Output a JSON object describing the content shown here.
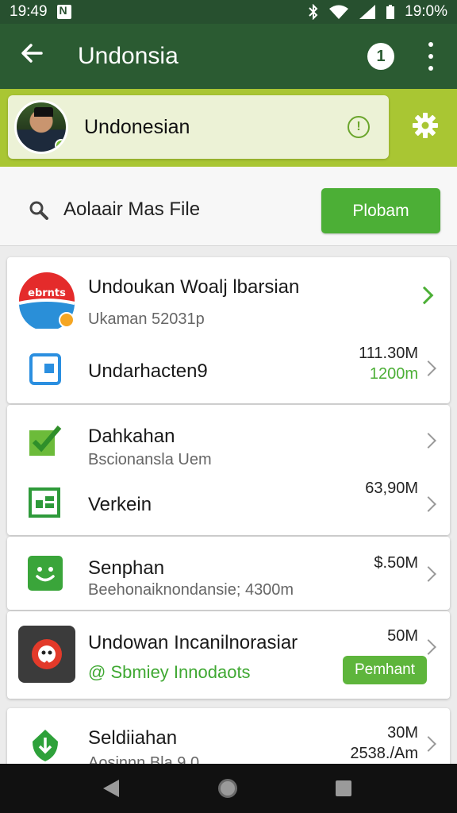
{
  "status": {
    "time": "19:49",
    "battery": "19:0%"
  },
  "appbar": {
    "title": "Undonsia",
    "info_label": "1"
  },
  "account": {
    "name": "Undonesian"
  },
  "search": {
    "label": "Aolaair Mas File",
    "button": "Plobam"
  },
  "cards": [
    {
      "rows": [
        {
          "title": "Undoukan Woalj lbarsian",
          "subtitle": "Ukaman 52031p",
          "icon": "brand-logo-icon"
        },
        {
          "title": "Undarhacten9",
          "size": "111.30M",
          "size2": "1200m",
          "icon": "tablet-icon"
        }
      ]
    },
    {
      "rows": [
        {
          "title": "Dahkahan",
          "subtitle": "Bscionansla Uem",
          "icon": "checkmark-icon"
        },
        {
          "title": "Verkein",
          "size": "63,90M",
          "icon": "spreadsheet-icon"
        }
      ]
    },
    {
      "rows": [
        {
          "title": "Senphan",
          "subtitle": "Beehonaiknondansie; 4300m",
          "size": "$.50M",
          "icon": "smiley-icon"
        }
      ]
    },
    {
      "rows": [
        {
          "title": "Undowan Incanilnorasiar",
          "subtitle": "@ Sbmiey Innodaots",
          "size": "50M",
          "button": "Pemhant",
          "icon": "app-red-icon"
        }
      ]
    },
    {
      "rows": [
        {
          "title": "Seldiiahan",
          "subtitle": "Aosinnn Bla 9.0",
          "size": "30M",
          "size2": "2538./Am",
          "icon": "shield-download-icon"
        }
      ]
    }
  ],
  "colors": {
    "header": "#2b5b32",
    "accent": "#4caf36",
    "lime": "#a9c633"
  }
}
